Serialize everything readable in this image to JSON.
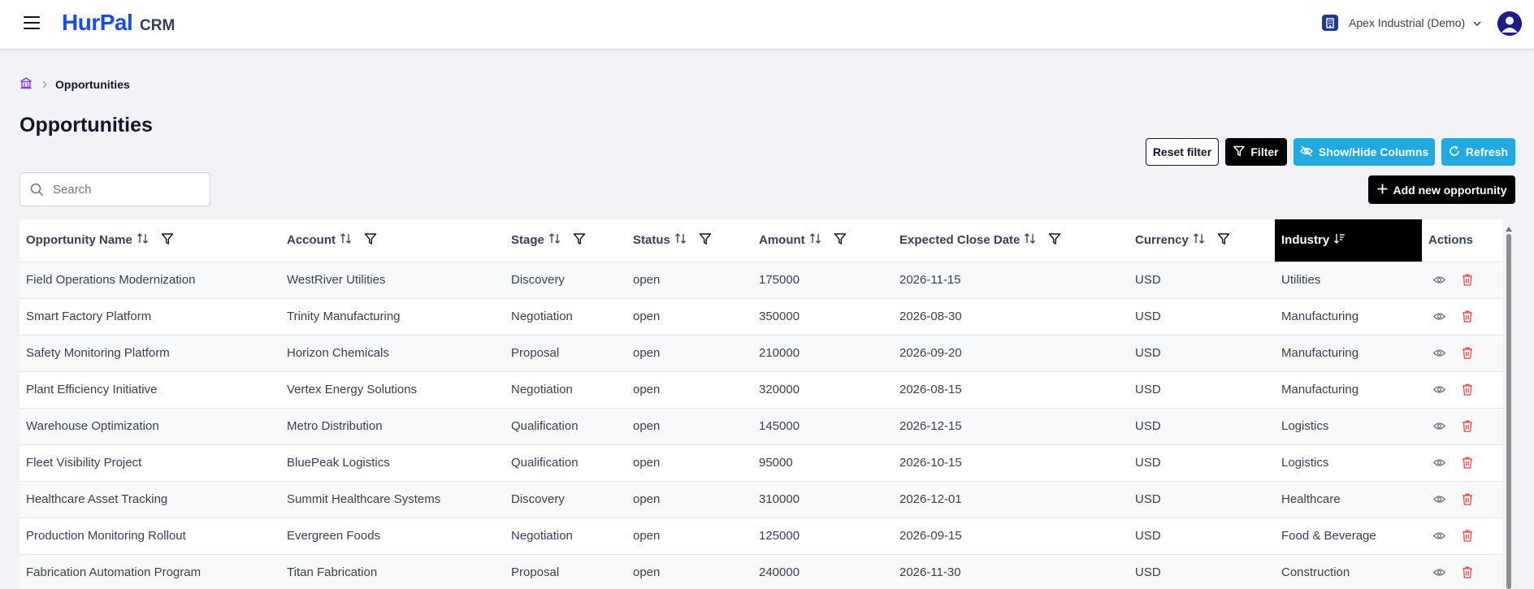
{
  "app": {
    "brand": "HurPal",
    "brand_sub": "CRM",
    "org_name": "Apex Industrial (Demo)"
  },
  "breadcrumb": {
    "current": "Opportunities"
  },
  "page": {
    "title": "Opportunities"
  },
  "toolbar": {
    "reset_label": "Reset filter",
    "filter_label": "Filter",
    "columns_label": "Show/Hide Columns",
    "refresh_label": "Refresh",
    "add_label": "Add new opportunity"
  },
  "search": {
    "placeholder": "Search",
    "value": ""
  },
  "colors": {
    "brand": "#1d4ed8",
    "accent": "#22a9e0",
    "danger": "#ef4444",
    "dark": "#000000"
  },
  "table": {
    "columns": [
      {
        "label": "Opportunity Name"
      },
      {
        "label": "Account"
      },
      {
        "label": "Stage"
      },
      {
        "label": "Status"
      },
      {
        "label": "Amount"
      },
      {
        "label": "Expected Close Date"
      },
      {
        "label": "Currency"
      },
      {
        "label": "Industry"
      },
      {
        "label": "Actions"
      }
    ],
    "rows": [
      [
        "Field Operations Modernization",
        "WestRiver Utilities",
        "Discovery",
        "open",
        "175000",
        "2026-11-15",
        "USD",
        "Utilities"
      ],
      [
        "Smart Factory Platform",
        "Trinity Manufacturing",
        "Negotiation",
        "open",
        "350000",
        "2026-08-30",
        "USD",
        "Manufacturing"
      ],
      [
        "Safety Monitoring Platform",
        "Horizon Chemicals",
        "Proposal",
        "open",
        "210000",
        "2026-09-20",
        "USD",
        "Manufacturing"
      ],
      [
        "Plant Efficiency Initiative",
        "Vertex Energy Solutions",
        "Negotiation",
        "open",
        "320000",
        "2026-08-15",
        "USD",
        "Manufacturing"
      ],
      [
        "Warehouse Optimization",
        "Metro Distribution",
        "Qualification",
        "open",
        "145000",
        "2026-12-15",
        "USD",
        "Logistics"
      ],
      [
        "Fleet Visibility Project",
        "BluePeak Logistics",
        "Qualification",
        "open",
        "95000",
        "2026-10-15",
        "USD",
        "Logistics"
      ],
      [
        "Healthcare Asset Tracking",
        "Summit Healthcare Systems",
        "Discovery",
        "open",
        "310000",
        "2026-12-01",
        "USD",
        "Healthcare"
      ],
      [
        "Production Monitoring Rollout",
        "Evergreen Foods",
        "Negotiation",
        "open",
        "125000",
        "2026-09-15",
        "USD",
        "Food & Beverage"
      ],
      [
        "Fabrication Automation Program",
        "Titan Fabrication",
        "Proposal",
        "open",
        "240000",
        "2026-11-30",
        "USD",
        "Construction"
      ]
    ]
  }
}
